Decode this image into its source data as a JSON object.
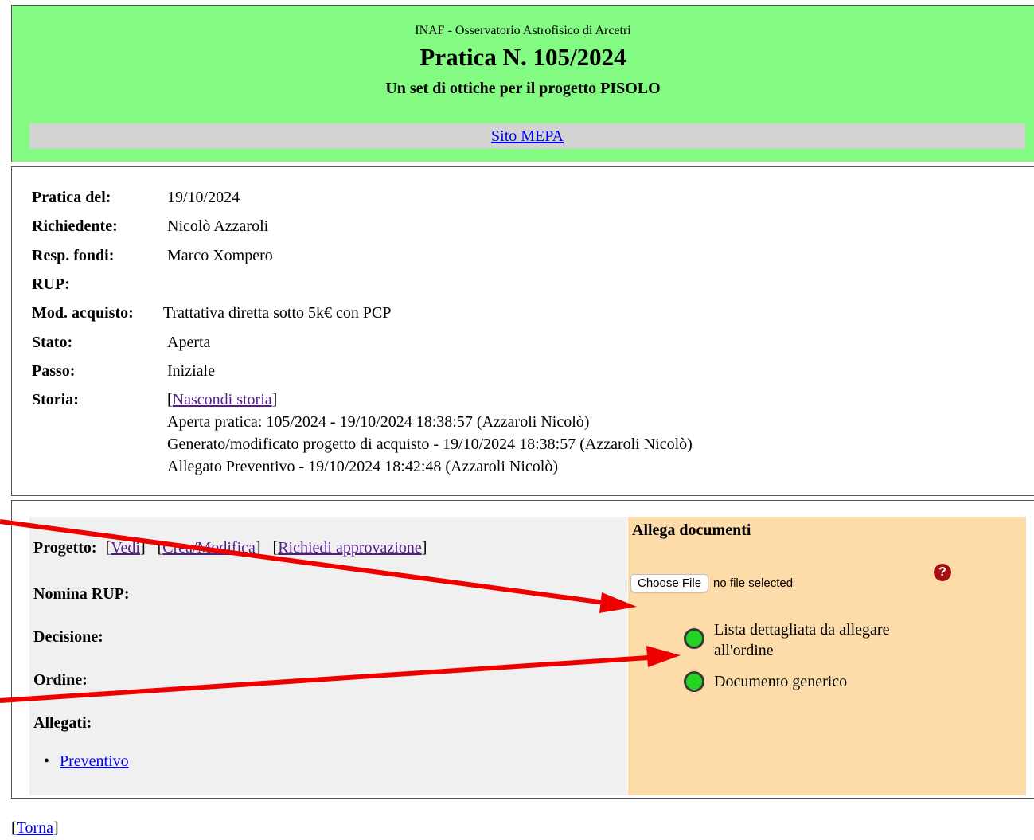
{
  "header": {
    "org": "INAF - Osservatorio Astrofisico di Arcetri",
    "title": "Pratica N. 105/2024",
    "subtitle": "Un set di ottiche per il progetto PISOLO",
    "mepa_link": "Sito MEPA",
    "background": "#84fc84"
  },
  "info": {
    "fields": [
      {
        "label": "Pratica del:",
        "value": "19/10/2024"
      },
      {
        "label": "Richiedente:",
        "value": "Nicolò Azzaroli"
      },
      {
        "label": "Resp. fondi:",
        "value": "Marco Xompero"
      },
      {
        "label": "RUP:",
        "value": ""
      },
      {
        "label": "Mod. acquisto:",
        "value": "Trattativa diretta sotto 5k€ con PCP"
      },
      {
        "label": "Stato:",
        "value": "Aperta"
      },
      {
        "label": "Passo:",
        "value": "Iniziale"
      },
      {
        "label": "Storia:",
        "value": ""
      }
    ],
    "history_toggle": "Nascondi storia",
    "history": [
      "Aperta pratica: 105/2024 - 19/10/2024 18:38:57 (Azzaroli Nicolò)",
      "Generato/modificato progetto di acquisto - 19/10/2024 18:38:57 (Azzaroli Nicolò)",
      "Allegato Preventivo - 19/10/2024 18:42:48 (Azzaroli Nicolò)"
    ]
  },
  "actions": {
    "progetto_label": "Progetto:",
    "progetto_links": [
      "Vedi",
      "Crea/Modifica",
      "Richiedi approvazione"
    ],
    "nomina_rup_label": "Nomina RUP:",
    "decisione_label": "Decisione:",
    "ordine_label": "Ordine:",
    "allegati_label": "Allegati:",
    "allegati": [
      "Preventivo"
    ]
  },
  "attach": {
    "title": "Allega documenti",
    "choose_file": "Choose File",
    "file_status": "no file selected",
    "help_icon": "question-circle-icon",
    "options": [
      "Lista dettagliata da allegare all'ordine",
      "Documento generico"
    ],
    "background": "#fddcaa"
  },
  "footer": {
    "back_link": "Torna"
  }
}
